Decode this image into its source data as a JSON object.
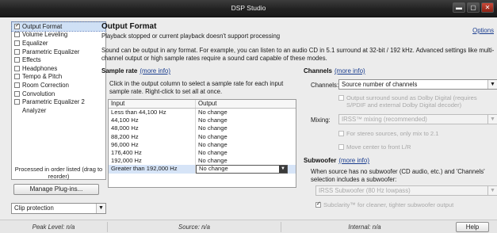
{
  "window": {
    "title": "DSP Studio",
    "minimize_glyph": "▬",
    "maximize_glyph": "▢",
    "close_glyph": "✕"
  },
  "sidebar": {
    "items": [
      {
        "label": "Output Format",
        "checked": true,
        "selected": true
      },
      {
        "label": "Volume Leveling",
        "checked": false
      },
      {
        "label": "Equalizer",
        "checked": false
      },
      {
        "label": "Parametric Equalizer",
        "checked": false
      },
      {
        "label": "Effects",
        "checked": false
      },
      {
        "label": "Headphones",
        "checked": false
      },
      {
        "label": "Tempo & Pitch",
        "checked": false
      },
      {
        "label": "Room Correction",
        "checked": false
      },
      {
        "label": "Convolution",
        "checked": false
      },
      {
        "label": "Parametric Equalizer 2",
        "checked": false
      },
      {
        "label": "Analyzer",
        "checked": null
      }
    ],
    "processed_note": "Processed in order listed (drag to reorder)",
    "manage_button": "Manage Plug-ins...",
    "clip_protection": "Clip protection"
  },
  "main": {
    "title": "Output Format",
    "subtitle": "Playback stopped or current playback doesn't support processing",
    "options_link": "Options",
    "description": "Sound can be output in any format.  For example, you can listen to an audio CD in 5.1 surround at 32-bit / 192 kHz.  Advanced settings like multi-channel output or high sample rates require a sound card capable of these modes.",
    "sample_rate": {
      "heading": "Sample rate",
      "more_info": "(more info)",
      "description": "Click in the output column to select a sample rate for each input sample rate.  Right-click to set all at once.",
      "col_input": "Input",
      "col_output": "Output",
      "rows": [
        {
          "input": "Less than 44,100 Hz",
          "output": "No change"
        },
        {
          "input": "44,100 Hz",
          "output": "No change"
        },
        {
          "input": "48,000 Hz",
          "output": "No change"
        },
        {
          "input": "88,200 Hz",
          "output": "No change"
        },
        {
          "input": "96,000 Hz",
          "output": "No change"
        },
        {
          "input": "176,400 Hz",
          "output": "No change"
        },
        {
          "input": "192,000 Hz",
          "output": "No change"
        },
        {
          "input": "Greater than 192,000 Hz",
          "output": "No change"
        }
      ]
    },
    "channels": {
      "heading": "Channels",
      "more_info": "(more info)",
      "channels_label": "Channels:",
      "channels_value": "Source number of channels",
      "bitstream_option": "Output surround sound as Dolby Digital (requires S/PDIF and external Dolby Digital decoder)",
      "mixing_label": "Mixing:",
      "mixing_value": "IRSS™ mixing (recommended)",
      "stereo_only_option": "For stereo sources, only mix to 2.1",
      "move_center_option": "Move center to front L/R"
    },
    "subwoofer": {
      "heading": "Subwoofer",
      "more_info": "(more info)",
      "description": "When source has no subwoofer (CD audio, etc.) and 'Channels' selection includes a subwoofer:",
      "select_value": "IRSS Subwoofer (80 Hz lowpass)",
      "subclarity_option": "Subclarity™ for cleaner, tighter subwoofer output"
    }
  },
  "status": {
    "peak_level": "Peak Level: n/a",
    "source": "Source: n/a",
    "internal": "Internal: n/a",
    "help_button": "Help"
  }
}
